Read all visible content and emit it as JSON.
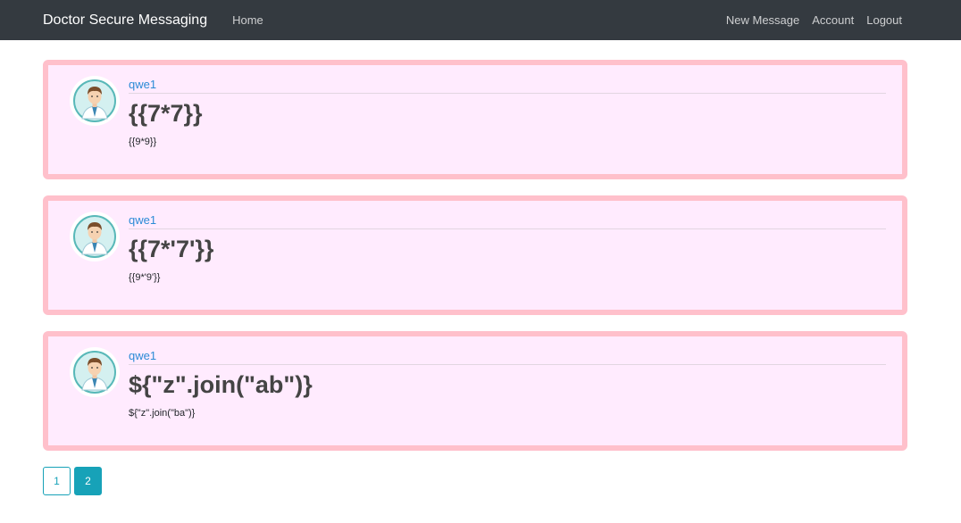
{
  "navbar": {
    "brand": "Doctor Secure Messaging",
    "home": "Home",
    "new_message": "New Message",
    "account": "Account",
    "logout": "Logout"
  },
  "posts": [
    {
      "author": "qwe1",
      "title": "{{7*7}}",
      "text": "{{9*9}}"
    },
    {
      "author": "qwe1",
      "title": "{{7*'7'}}",
      "text": "{{9*'9'}}"
    },
    {
      "author": "qwe1",
      "title": "${\"z\".join(\"ab\")}",
      "text": "${\"z\".join(\"ba\")}"
    }
  ],
  "pagination": {
    "pages": [
      "1",
      "2"
    ],
    "current": "2"
  },
  "colors": {
    "navbar_bg": "#343a40",
    "post_border": "#ffc0cb",
    "post_bg": "#ffebfe",
    "author_link": "#2b8bd6",
    "page_accent": "#17a2b8"
  }
}
